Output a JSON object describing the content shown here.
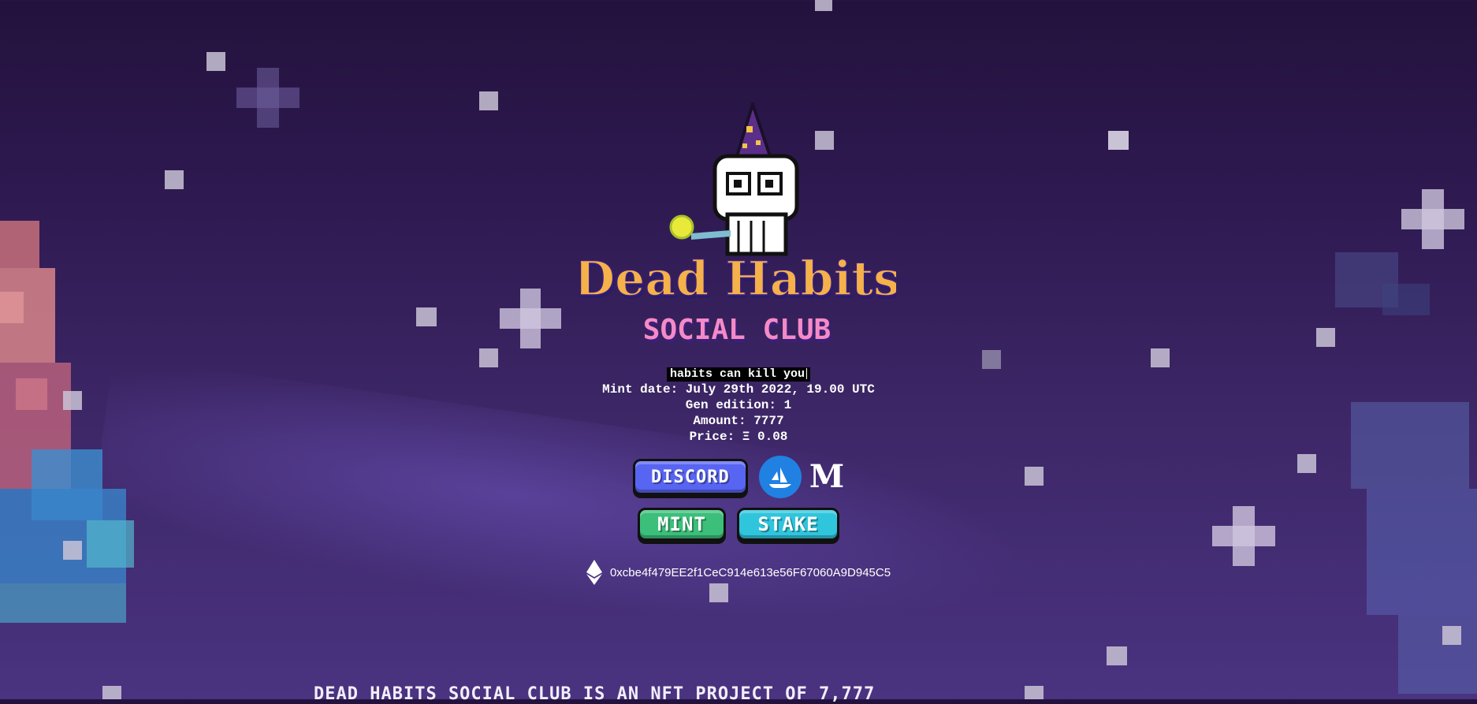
{
  "header": {
    "title_line1": "Dead Habits",
    "title_line2": "SOCIAL CLUB",
    "tagline": "habits can kill you"
  },
  "info": {
    "mint_date": "Mint date: July 29th 2022, 19.00 UTC",
    "gen_edition": "Gen edition: 1",
    "amount": "Amount: 7777",
    "price": "Price: Ξ 0.08"
  },
  "links": {
    "discord_label": "DISCORD",
    "opensea_icon": "opensea-icon",
    "medium_label": "M"
  },
  "actions": {
    "mint_label": "MINT",
    "stake_label": "STAKE"
  },
  "contract": {
    "icon": "ethereum-icon",
    "address": "0xcbe4f479EE2f1CeC914e613e56F67060A9D945C5"
  },
  "footer": {
    "text": "DEAD HABITS SOCIAL CLUB IS AN NFT PROJECT OF 7,777"
  },
  "colors": {
    "discord": "#5865f2",
    "mint": "#3bbf7b",
    "stake": "#2fc5dd",
    "opensea": "#2081e2"
  }
}
